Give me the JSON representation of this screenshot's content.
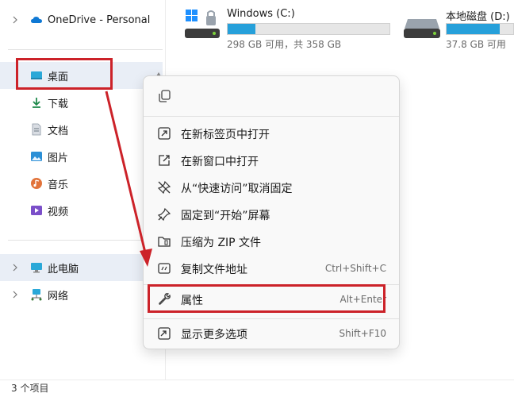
{
  "sidebar": {
    "top_item": {
      "label": "OneDrive - Personal",
      "icon": "cloud-icon"
    },
    "quick_access": [
      {
        "label": "桌面",
        "icon": "desktop-icon",
        "selected": true,
        "pinned": true
      },
      {
        "label": "下载",
        "icon": "download-icon"
      },
      {
        "label": "文档",
        "icon": "document-icon"
      },
      {
        "label": "图片",
        "icon": "picture-icon"
      },
      {
        "label": "音乐",
        "icon": "music-icon"
      },
      {
        "label": "视频",
        "icon": "video-icon"
      }
    ],
    "locations": [
      {
        "label": "此电脑",
        "icon": "pc-icon",
        "selected": true
      },
      {
        "label": "网络",
        "icon": "network-icon"
      }
    ]
  },
  "drives": [
    {
      "name": "Windows (C:)",
      "free": "298 GB 可用，共 358 GB",
      "used_fraction": 0.17,
      "icon": "windows-drive-icon"
    },
    {
      "name": "本地磁盘 (D:)",
      "free": "37.8 GB 可用",
      "used_fraction": 0.8,
      "icon": "drive-icon"
    }
  ],
  "context_menu": {
    "top_actions": [
      {
        "icon": "copy-icon"
      }
    ],
    "items": [
      {
        "label": "在新标签页中打开",
        "icon": "open-new-tab-icon",
        "shortcut": ""
      },
      {
        "label": "在新窗口中打开",
        "icon": "open-new-window-icon",
        "shortcut": ""
      },
      {
        "label": "从“快速访问”取消固定",
        "icon": "unpin-icon",
        "shortcut": ""
      },
      {
        "label": "固定到“开始”屏幕",
        "icon": "pin-icon",
        "shortcut": ""
      },
      {
        "label": "压缩为 ZIP 文件",
        "icon": "zip-folder-icon",
        "shortcut": ""
      },
      {
        "label": "复制文件地址",
        "icon": "copy-path-icon",
        "shortcut": "Ctrl+Shift+C"
      },
      {
        "label": "属性",
        "icon": "wrench-icon",
        "shortcut": "Alt+Enter",
        "highlighted": true
      },
      {
        "label": "显示更多选项",
        "icon": "more-options-icon",
        "shortcut": "Shift+F10"
      }
    ]
  },
  "statusbar": {
    "text": "3 个项目"
  },
  "colors": {
    "annotation_red": "#cc2229",
    "selection_bg": "#e9eef6",
    "drive_bar_fill": "#26a0da",
    "accent_blue": "#0067c0"
  }
}
